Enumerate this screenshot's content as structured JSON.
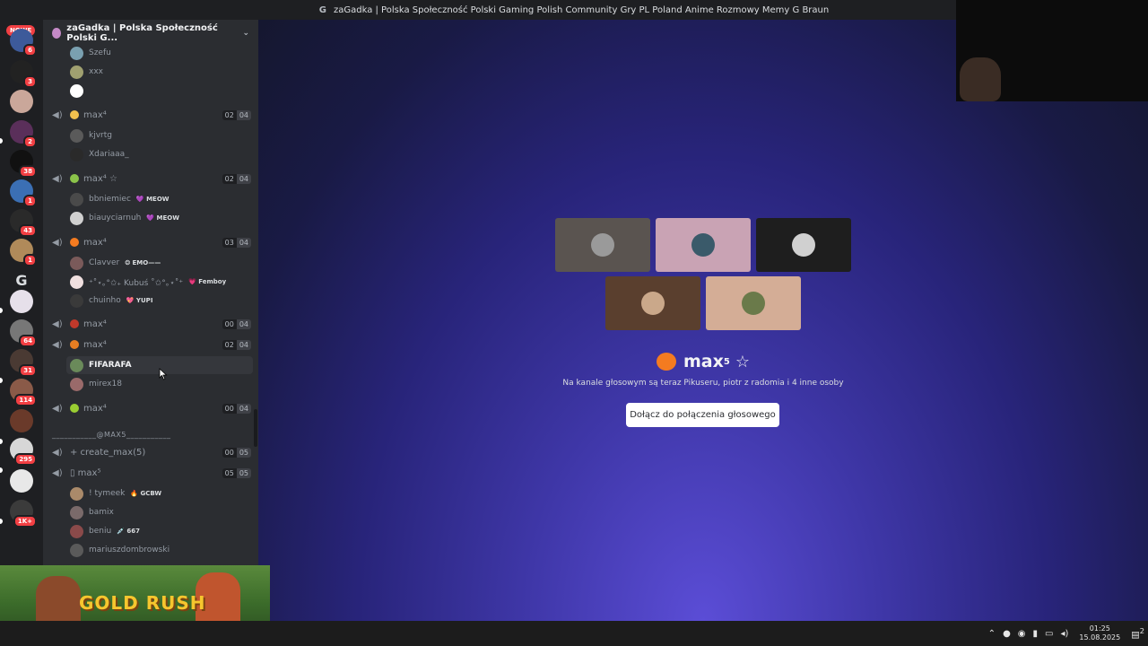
{
  "window": {
    "title": "zaGadka | Polska Społeczność Polski Gaming Polish Community Gry PL Poland Anime Rozmowy Memy G Braun",
    "title_icon": "G"
  },
  "rail": {
    "new_badge": "NOWE",
    "servers": [
      {
        "badge": "6",
        "color": "#3d5a9a"
      },
      {
        "badge": "3",
        "color": "#222222"
      },
      {
        "badge": "",
        "color": "#caa79a"
      },
      {
        "badge": "2",
        "color": "#5a2f5a"
      },
      {
        "badge": "38",
        "color": "#111111"
      },
      {
        "badge": "1",
        "color": "#3b6fb4"
      },
      {
        "badge": "43",
        "color": "#2a2a2a"
      },
      {
        "badge": "1",
        "color": "#b08a5a"
      },
      {
        "badge": "",
        "color": "#2b2d31"
      },
      {
        "badge": "",
        "color": "#e6e0ea"
      },
      {
        "badge": "64",
        "color": "#777777"
      },
      {
        "badge": "31",
        "color": "#4a3a33"
      },
      {
        "badge": "114",
        "color": "#8a5a48"
      },
      {
        "badge": "",
        "color": "#6a3a2a"
      },
      {
        "badge": "295",
        "color": "#d7d7d7"
      },
      {
        "badge": "",
        "color": "#e8e8e8"
      },
      {
        "badge": "1K+",
        "color": "#3b3b3b"
      }
    ]
  },
  "guild": {
    "name": "zaGadka | Polska Społeczność Polski G..."
  },
  "channels": {
    "top_users": [
      {
        "name": "Szefu",
        "color": "#7aa0b0"
      },
      {
        "name": "xxx",
        "color": "#a0a070"
      },
      {
        "name": "",
        "color": "#ffffff"
      }
    ],
    "voice": [
      {
        "name": "max⁴",
        "emoji_color": "#f2c14e",
        "count": "02",
        "limit": "04",
        "users": [
          {
            "name": "kjvrtg",
            "color": "#5a5a5a",
            "tag": ""
          },
          {
            "name": "Xdariaaa_",
            "color": "#2a2a2a",
            "tag": ""
          }
        ]
      },
      {
        "name": "max⁴ ☆",
        "emoji_color": "#8bc34a",
        "count": "02",
        "limit": "04",
        "users": [
          {
            "name": "bbniemiec",
            "color": "#4a4a4a",
            "tag": "💜 MEOW"
          },
          {
            "name": "biauyciarnuh",
            "color": "#d0d0d0",
            "tag": "💜 MEOW"
          }
        ]
      },
      {
        "name": "max⁴",
        "emoji_color": "#f47b20",
        "count": "03",
        "limit": "04",
        "users": [
          {
            "name": "Clavver",
            "color": "#7a5a5a",
            "tag": "❂ EMO——"
          },
          {
            "name": "⁺˚⋆｡°✩₊ Kubuś ˚✩°｡⋆˚⁺",
            "color": "#f0e0e0",
            "tag": "💗 Femboy"
          },
          {
            "name": "chuinho",
            "color": "#3a3a3a",
            "tag": "💖 YUPI"
          }
        ]
      },
      {
        "name": "max⁴",
        "emoji_color": "#c0392b",
        "count": "00",
        "limit": "04",
        "users": []
      },
      {
        "name": "max⁴",
        "emoji_color": "#e67e22",
        "count": "02",
        "limit": "04",
        "users": [
          {
            "name": "FIFARAFA",
            "color": "#6a8a5a",
            "tag": ""
          },
          {
            "name": "mirex18",
            "color": "#9a6a6a",
            "tag": ""
          }
        ]
      },
      {
        "name": "max⁴",
        "emoji_color": "#9acd32",
        "count": "00",
        "limit": "04",
        "users": []
      }
    ],
    "category": "___________@MAX5___________",
    "voice2": [
      {
        "name": "+ create_max(5)",
        "count": "00",
        "limit": "05",
        "users": []
      },
      {
        "name": "▯ max⁵",
        "count": "05",
        "limit": "05",
        "users": [
          {
            "name": "! tymeek",
            "color": "#aa8a6a",
            "tag": "🔥 GCBW"
          },
          {
            "name": "bamix",
            "color": "#7a6a6a",
            "tag": ""
          },
          {
            "name": "beniu",
            "color": "#8a4a4a",
            "tag": "💉 667"
          },
          {
            "name": "mariuszdombrowski",
            "color": "#5a5a5a",
            "tag": ""
          }
        ]
      }
    ]
  },
  "main": {
    "tiles": [
      {
        "bg": "#5a5450",
        "avatar": "#9a9a9a"
      },
      {
        "bg": "#c9a3b4",
        "avatar": "#3a5a6a"
      },
      {
        "bg": "#1e1e1e",
        "avatar": "#d0d0d0"
      },
      {
        "bg": "#5a3f2e",
        "avatar": "#caa88a"
      },
      {
        "bg": "#d4ad96",
        "avatar": "#6a7a4a"
      }
    ],
    "channel_name": "max",
    "channel_sup": "5",
    "channel_star": "☆",
    "subtitle": "Na kanale głosowym są teraz Pikuseru, piotr z radomia i 4 inne osoby",
    "join_label": "Dołącz do połączenia głosowego"
  },
  "game_overlay": {
    "text": "GOLD RUSH"
  },
  "taskbar": {
    "time": "01:25",
    "date": "15.08.2025",
    "notif_count": "2"
  }
}
